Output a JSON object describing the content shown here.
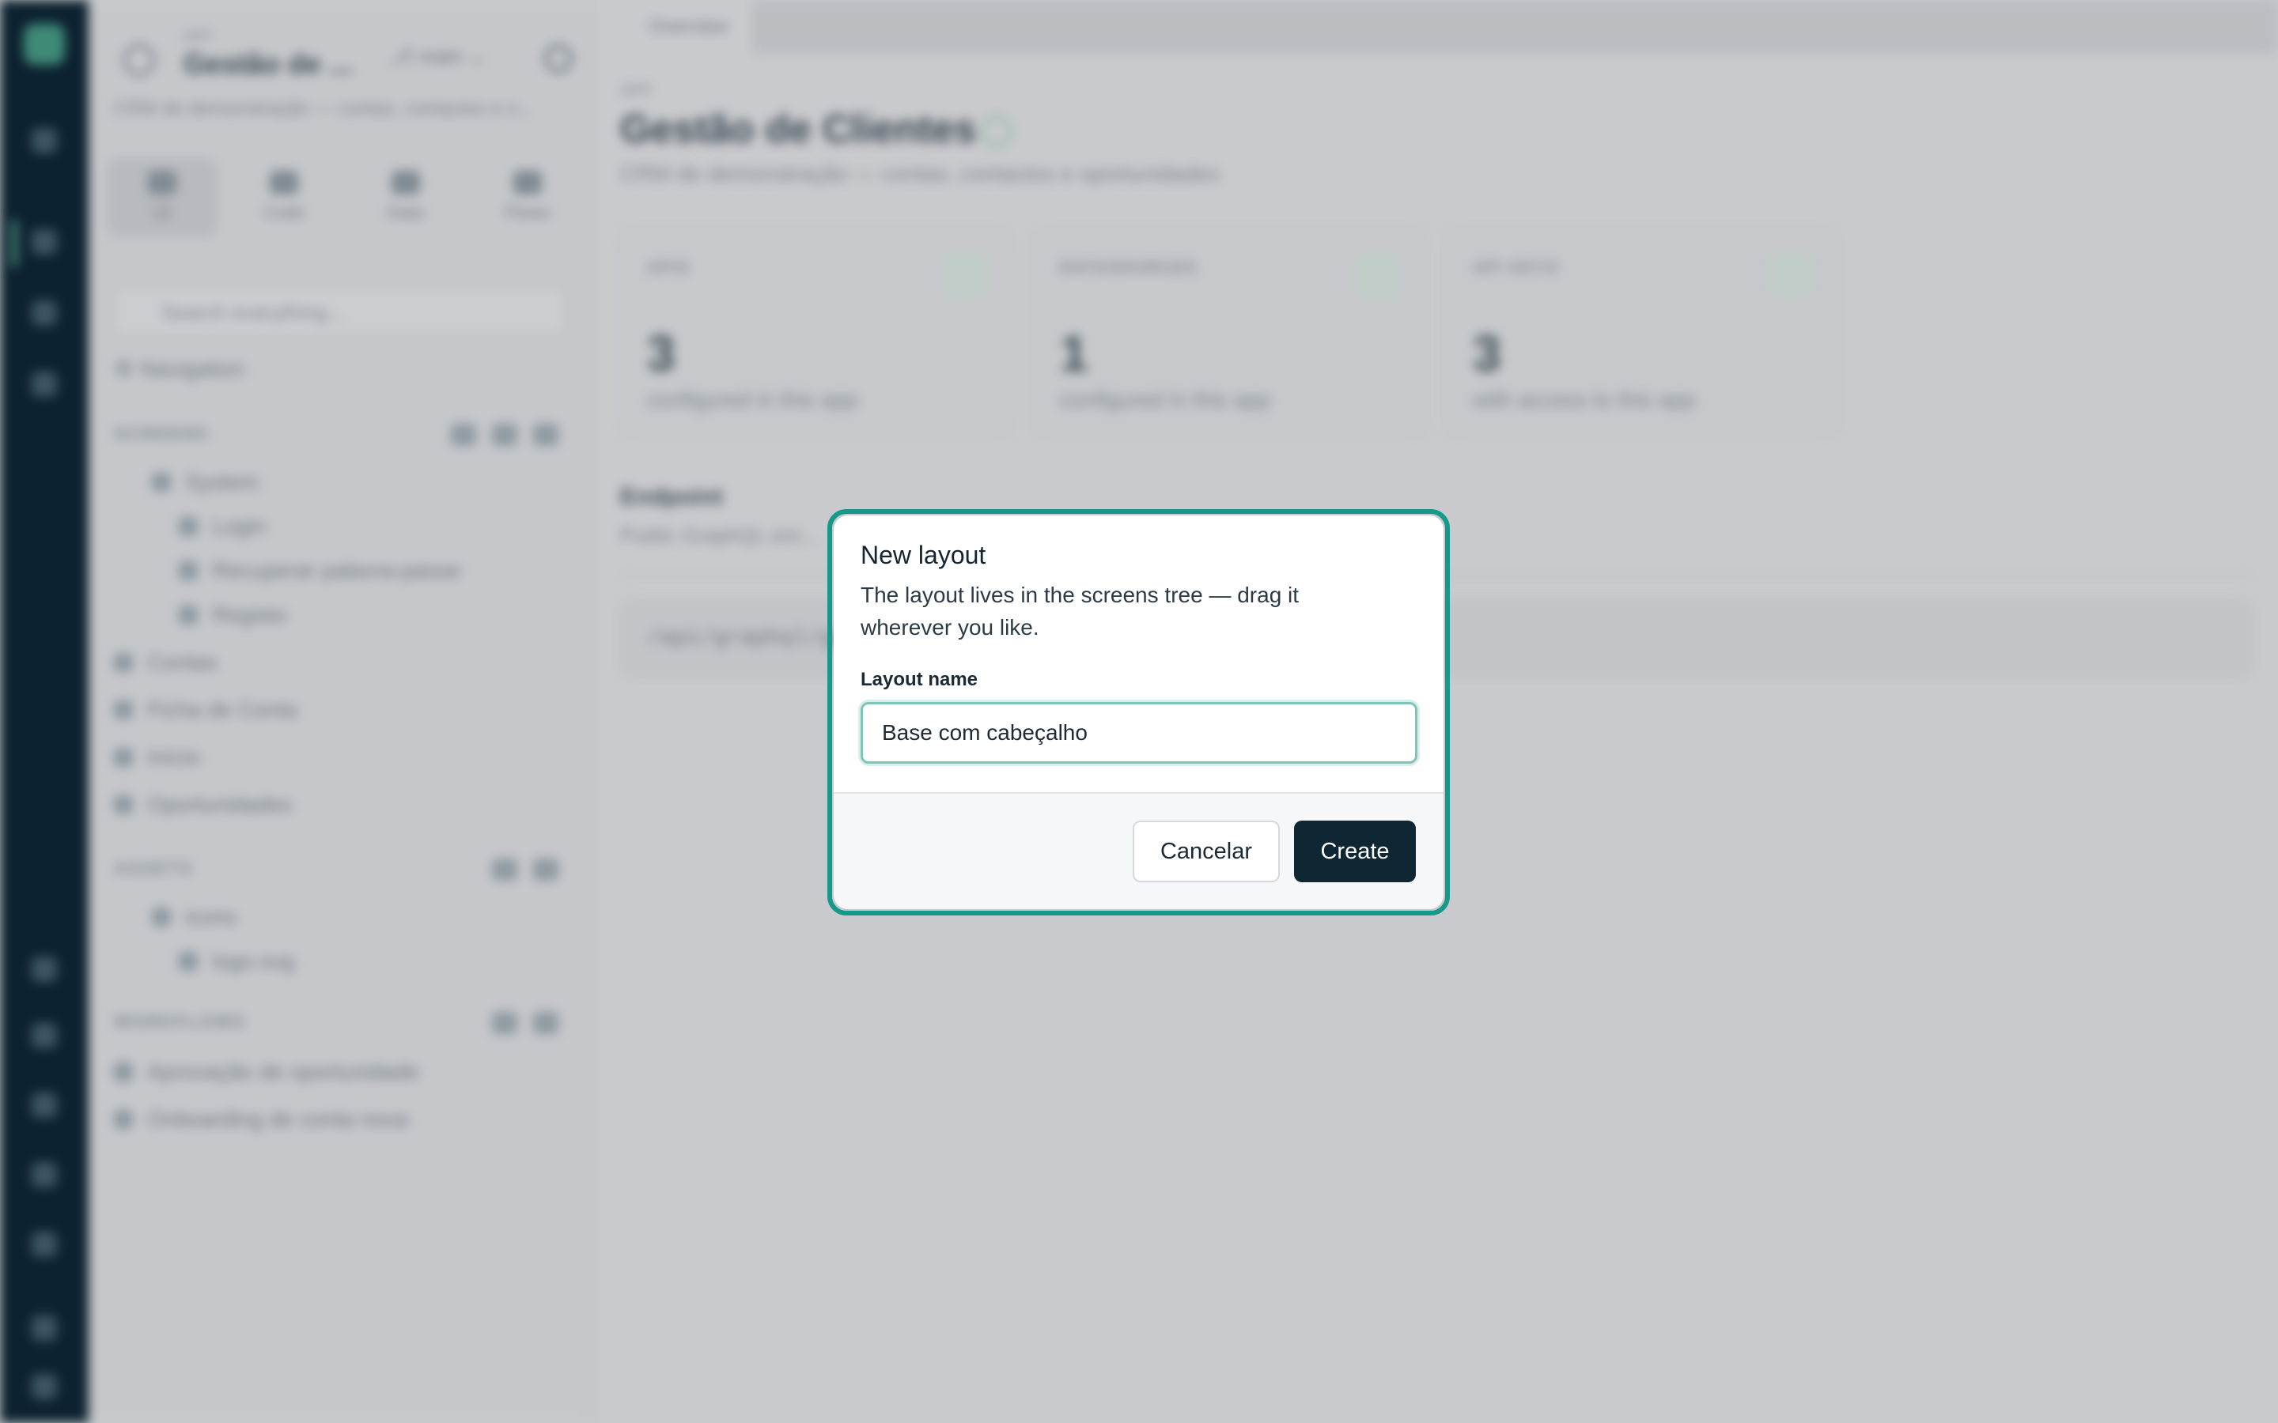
{
  "sidebar": {
    "app_label": "APP",
    "app_name": "Gestão de ...",
    "branch": "main",
    "description": "CRM de demonstração — contas, contactos e o...",
    "tabs": [
      {
        "label": "UI"
      },
      {
        "label": "Code"
      },
      {
        "label": "Data"
      },
      {
        "label": "Flows"
      }
    ],
    "search_placeholder": "Search everything...",
    "navigation_label": "Navigation",
    "sections": {
      "screens": {
        "title": "SCREENS",
        "items": [
          "System",
          "Login",
          "Recuperar palavra-passe",
          "Registo",
          "Contas",
          "Ficha de Conta",
          "Início",
          "Oportunidades"
        ]
      },
      "assets": {
        "title": "ASSETS",
        "items": [
          "icons",
          "logo.svg"
        ]
      },
      "workflows": {
        "title": "WORKFLOWS",
        "items": [
          "Aprovação de oportunidade",
          "Onboarding de conta nova"
        ]
      }
    }
  },
  "main": {
    "tab": "Overview",
    "breadcrumb": "APP",
    "title": "Gestão de Clientes",
    "subtitle": "CRM de demonstração — contas, contactos e oportunidades",
    "cards": [
      {
        "label": "APIS",
        "value": "3",
        "sub": "configured in this app"
      },
      {
        "label": "DATASOURCES",
        "value": "1",
        "sub": "configured in this app"
      },
      {
        "label": "API KEYS",
        "value": "3",
        "sub": "with access to this app"
      }
    ],
    "endpoint": {
      "title": "Endpoint",
      "subtitle": "Public GraphQL ent...",
      "value": "/api/graphql/gest..."
    }
  },
  "modal": {
    "title": "New layout",
    "description": "The layout lives in the screens tree — drag it wherever you like.",
    "field_label": "Layout name",
    "field_value": "Base com cabeçalho",
    "cancel_label": "Cancelar",
    "create_label": "Create"
  },
  "colors": {
    "accent": "#14998a",
    "primary_button": "#0f2633",
    "rail": "#0d2230"
  }
}
